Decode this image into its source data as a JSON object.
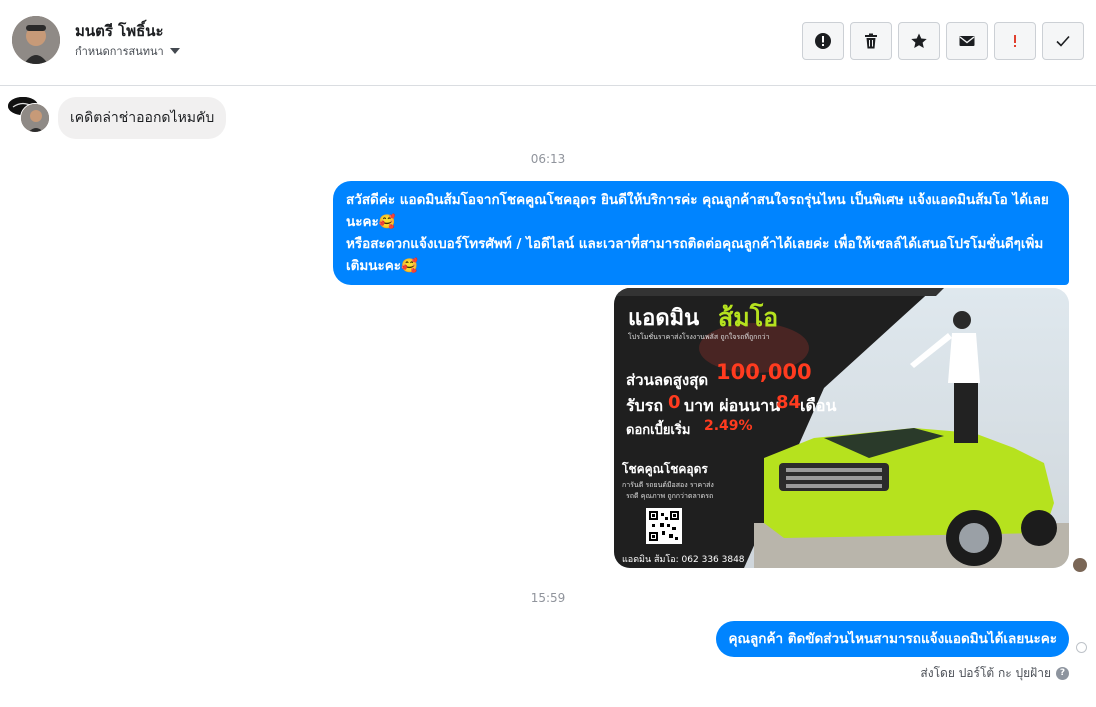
{
  "header": {
    "contact_name": "มนตรี โพธิ์นะ",
    "assign_label": "กำหนดการสนทนา",
    "toolbar": [
      {
        "name": "report-spam-button",
        "icon": "alert-circle-icon"
      },
      {
        "name": "delete-button",
        "icon": "trash-icon"
      },
      {
        "name": "star-button",
        "icon": "star-icon"
      },
      {
        "name": "mark-unread-button",
        "icon": "envelope-icon"
      },
      {
        "name": "follow-up-button",
        "icon": "exclamation-icon"
      },
      {
        "name": "mark-done-button",
        "icon": "check-icon"
      }
    ]
  },
  "messages": {
    "incoming_1": "เคดิตล่าช่าออกดไหมคับ",
    "time_1": "06:13",
    "outgoing_1": "สวัสดีค่ะ แอดมินส้มโอจากโชคคูณโชคอุดร ยินดีให้บริการค่ะ   คุณลูกค้าสนใจรถรุ่นไหน เป็นพิเศษ แจ้งแอดมินส้มโอ ได้เลยนะคะ🥰\nหรือสะดวกแจ้งเบอร์โทรศัพท์ / ไอดีไลน์ และเวลาที่สามารถติดต่อคุณลูกค้าได้เลยค่ะ เพื่อให้เซลล์ได้เสนอโปรโมชั่นดีๆเพิ่มเติมนะคะ🥰",
    "time_2": "15:59",
    "outgoing_2": "คุณลูกค้า ติดขัดส่วนไหนสามารถแจ้งแอดมินได้เลยนะคะ",
    "sent_by": "ส่งโดย ปอร์โต้ กะ ปุยฝ้าย"
  },
  "ad": {
    "title_1": "แอดมิน",
    "title_2": "ส้มโอ",
    "tagline": "โปรโมชั่นราคาส่งโรงงานพลัส ถูกใจรถที่ถูกกว่า",
    "discount_label": "ส่วนลดสูงสุด",
    "discount_value": "100,000",
    "down_label": "รับรถ",
    "down_value": "0",
    "down_unit": "บาท ผ่อนนาน",
    "months_value": "84",
    "months_unit": "เดือน",
    "interest_label": "ดอกเบี้ยเริ่ม",
    "interest_value": "2.49%",
    "dealer_name": "โชคคูณโชคอุดร",
    "dealer_line1": "การันตี รถยนต์มือสอง ราคาส่ง",
    "dealer_line2": "รถดี คุณภาพ ถูกกว่าตลาดรถ",
    "contact": "แอดมิน ส้มโอ: 062 336 3848",
    "colors": {
      "accent": "#ff3b1f",
      "lime": "#b6e21e",
      "dark": "#1f1f1f"
    }
  }
}
